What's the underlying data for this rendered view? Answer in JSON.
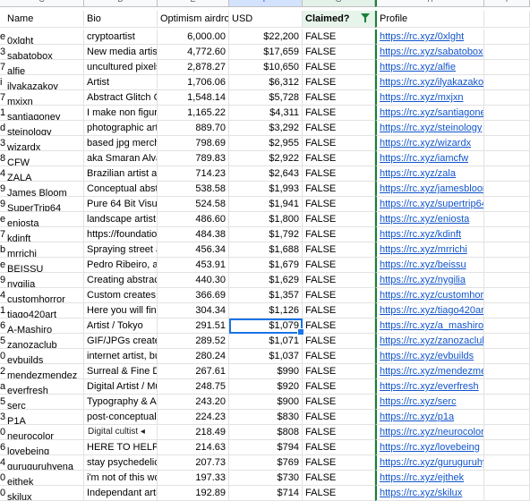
{
  "column_letters": [
    "C",
    "D",
    "E",
    "F",
    "G",
    "H",
    "I"
  ],
  "headers": {
    "name": "Name",
    "bio": "Bio",
    "airdrop": "Optimism airdrop",
    "usd": "USD",
    "claimed": "Claimed?",
    "profile": "Profile"
  },
  "rows": [
    {
      "prefix": "e",
      "name": "0xlght",
      "bio": "cryptoartist",
      "airdrop": "6,000.00",
      "usd": "$22,200",
      "claimed": "FALSE",
      "profile": "https://rc.xyz/0xlght"
    },
    {
      "prefix": "3",
      "name": "sabatobox",
      "bio": "New media artist",
      "airdrop": "4,772.60",
      "usd": "$17,659",
      "claimed": "FALSE",
      "profile": "https://rc.xyz/sabatobox"
    },
    {
      "prefix": "7",
      "name": "alfie",
      "bio": "uncultured pixels",
      "airdrop": "2,878.27",
      "usd": "$10,650",
      "claimed": "FALSE",
      "profile": "https://rc.xyz/alfie"
    },
    {
      "prefix": "i",
      "name": "ilyakazakov",
      "bio": "Artist",
      "airdrop": "1,706.06",
      "usd": "$6,312",
      "claimed": "FALSE",
      "profile": "https://rc.xyz/ilyakazakov"
    },
    {
      "prefix": "7",
      "name": "mxjxn",
      "bio": "Abstract Glitch C",
      "airdrop": "1,548.14",
      "usd": "$5,728",
      "claimed": "FALSE",
      "profile": "https://rc.xyz/mxjxn"
    },
    {
      "prefix": "1",
      "name": "santiagoney",
      "bio": "I make non figura",
      "airdrop": "1,165.22",
      "usd": "$4,311",
      "claimed": "FALSE",
      "profile": "https://rc.xyz/santiagoney"
    },
    {
      "prefix": "d",
      "name": "steinology",
      "bio": "photographic art",
      "airdrop": "889.70",
      "usd": "$3,292",
      "claimed": "FALSE",
      "profile": "https://rc.xyz/steinology"
    },
    {
      "prefix": "3",
      "name": "wizardx",
      "bio": "based jpg merch",
      "airdrop": "798.69",
      "usd": "$2,955",
      "claimed": "FALSE",
      "profile": "https://rc.xyz/wizardx"
    },
    {
      "prefix": "8",
      "name": "CFW",
      "bio": "aka Smaran Alva",
      "airdrop": "789.83",
      "usd": "$2,922",
      "claimed": "FALSE",
      "profile": "https://rc.xyz/iamcfw"
    },
    {
      "prefix": "4",
      "name": "ZALA",
      "bio": "Brazilian artist ar",
      "airdrop": "714.23",
      "usd": "$2,643",
      "claimed": "FALSE",
      "profile": "https://rc.xyz/zala"
    },
    {
      "prefix": "9",
      "name": "James Bloom",
      "bio": "Conceptual abst",
      "airdrop": "538.58",
      "usd": "$1,993",
      "claimed": "FALSE",
      "profile": "https://rc.xyz/jamesbloom"
    },
    {
      "prefix": "9",
      "name": "SuperTrip64",
      "bio": "Pure 64 Bit Visua",
      "airdrop": "524.58",
      "usd": "$1,941",
      "claimed": "FALSE",
      "profile": "https://rc.xyz/supertrip64"
    },
    {
      "prefix": "e",
      "name": "eniosta",
      "bio": "landscape artist",
      "airdrop": "486.60",
      "usd": "$1,800",
      "claimed": "FALSE",
      "profile": "https://rc.xyz/eniosta"
    },
    {
      "prefix": "7",
      "name": "kdinft",
      "bio": "https://foundation",
      "airdrop": "484.38",
      "usd": "$1,792",
      "claimed": "FALSE",
      "profile": "https://rc.xyz/kdinft"
    },
    {
      "prefix": "b",
      "name": "mrrichi",
      "bio": "Spraying street a",
      "airdrop": "456.34",
      "usd": "$1,688",
      "claimed": "FALSE",
      "profile": "https://rc.xyz/mrrichi"
    },
    {
      "prefix": "e",
      "name": "BEISSU",
      "bio": "Pedro Ribeiro, a",
      "airdrop": "453.91",
      "usd": "$1,679",
      "claimed": "FALSE",
      "profile": "https://rc.xyz/beissu"
    },
    {
      "prefix": "9",
      "name": "nygilia",
      "bio": "Creating abstrac",
      "airdrop": "440.30",
      "usd": "$1,629",
      "claimed": "FALSE",
      "profile": "https://rc.xyz/nygilia"
    },
    {
      "prefix": "4",
      "name": "customhorror",
      "bio": "Custom creates",
      "airdrop": "366.69",
      "usd": "$1,357",
      "claimed": "FALSE",
      "profile": "https://rc.xyz/customhorror"
    },
    {
      "prefix": "1",
      "name": "tiago420art",
      "bio": "Here you will finc",
      "airdrop": "304.34",
      "usd": "$1,126",
      "claimed": "FALSE",
      "profile": "https://rc.xyz/tiago420art"
    },
    {
      "prefix": "6",
      "name": "A-Mashiro",
      "bio": "Artist / Tokyo",
      "airdrop": "291.51",
      "usd": "$1,079",
      "claimed": "FALSE",
      "profile": "https://rc.xyz/a_mashiro"
    },
    {
      "prefix": "5",
      "name": "zanozaclub",
      "bio": "GIF/JPGs create",
      "airdrop": "289.52",
      "usd": "$1,071",
      "claimed": "FALSE",
      "profile": "https://rc.xyz/zanozaclub"
    },
    {
      "prefix": "0",
      "name": "evbuilds",
      "bio": "internet artist, bu",
      "airdrop": "280.24",
      "usd": "$1,037",
      "claimed": "FALSE",
      "profile": "https://rc.xyz/evbuilds"
    },
    {
      "prefix": "2",
      "name": "mendezmendez",
      "bio": "Surreal & Fine D",
      "airdrop": "267.61",
      "usd": "$990",
      "claimed": "FALSE",
      "profile": "https://rc.xyz/mendezmendez"
    },
    {
      "prefix": "a",
      "name": "everfresh",
      "bio": "Digital Artist / Mu",
      "airdrop": "248.75",
      "usd": "$920",
      "claimed": "FALSE",
      "profile": "https://rc.xyz/everfresh"
    },
    {
      "prefix": "5",
      "name": "serc",
      "bio": "Typography & AI",
      "airdrop": "243.20",
      "usd": "$900",
      "claimed": "FALSE",
      "profile": "https://rc.xyz/serc"
    },
    {
      "prefix": "3",
      "name": "P1A",
      "bio": "post-conceptual",
      "airdrop": "224.23",
      "usd": "$830",
      "claimed": "FALSE",
      "profile": "https://rc.xyz/p1a"
    },
    {
      "prefix": "0",
      "name": "neurocolor",
      "bio": "",
      "airdrop": "218.49",
      "usd": "$808",
      "claimed": "FALSE",
      "profile": "https://rc.xyz/neurocolor"
    },
    {
      "prefix": "6",
      "name": "lovebeing",
      "bio": "HERE TO HELP",
      "airdrop": "214.63",
      "usd": "$794",
      "claimed": "FALSE",
      "profile": "https://rc.xyz/lovebeing"
    },
    {
      "prefix": "4",
      "name": "guruguruhyena",
      "bio": "stay psychedelic",
      "airdrop": "207.73",
      "usd": "$769",
      "claimed": "FALSE",
      "profile": "https://rc.xyz/guruguruhyena"
    },
    {
      "prefix": "0",
      "name": "ejthek",
      "bio": "i'm not of this wo",
      "airdrop": "197.33",
      "usd": "$730",
      "claimed": "FALSE",
      "profile": "https://rc.xyz/ejthek"
    },
    {
      "prefix": "0",
      "name": "skilux",
      "bio": "Independant arti",
      "airdrop": "192.89",
      "usd": "$714",
      "claimed": "FALSE",
      "profile": "https://rc.xyz/skilux"
    }
  ],
  "overlay_text": "Digital  cultist ◂"
}
